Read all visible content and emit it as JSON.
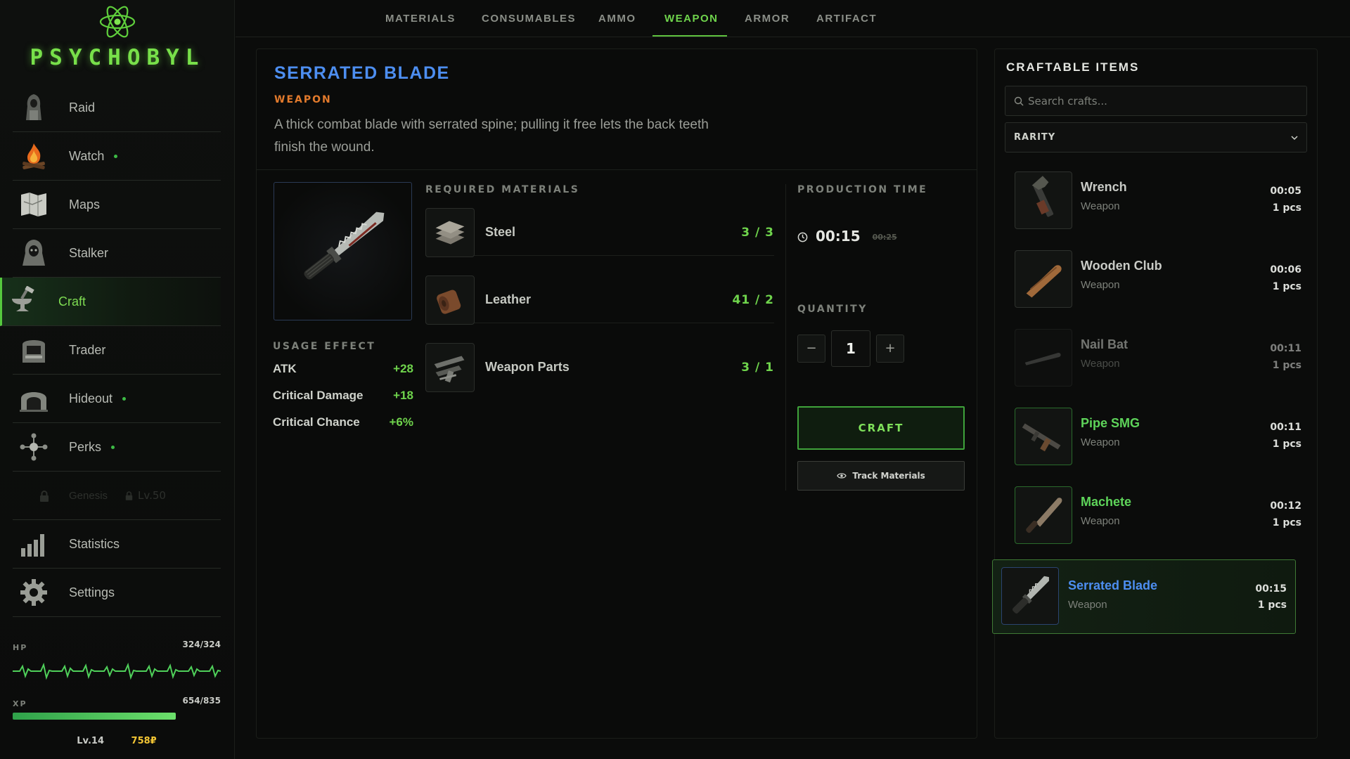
{
  "app": {
    "title": "PSYCHOBYL"
  },
  "sidebar": {
    "items": [
      {
        "label": "Raid",
        "icon": "hooded-figure-icon",
        "dot": false
      },
      {
        "label": "Watch",
        "icon": "campfire-icon",
        "dot": true
      },
      {
        "label": "Maps",
        "icon": "map-icon",
        "dot": false
      },
      {
        "label": "Stalker",
        "icon": "stalker-icon",
        "dot": false
      },
      {
        "label": "Craft",
        "icon": "anvil-icon",
        "dot": false,
        "active": true
      },
      {
        "label": "Trader",
        "icon": "trader-booth-icon",
        "dot": false
      },
      {
        "label": "Hideout",
        "icon": "bunker-icon",
        "dot": true
      },
      {
        "label": "Perks",
        "icon": "perks-icon",
        "dot": true
      },
      {
        "label": "Genesis",
        "icon": "lock-icon",
        "locked": true,
        "level": "Lv.50"
      },
      {
        "label": "Statistics",
        "icon": "bar-chart-icon",
        "dot": false
      },
      {
        "label": "Settings",
        "icon": "gear-icon",
        "dot": false
      }
    ]
  },
  "player": {
    "hp_label": "HP",
    "hp_value": "324/324",
    "xp_label": "XP",
    "xp_value": "654/835",
    "xp_fraction": 0.783,
    "level": "Lv.14",
    "money": "758₽"
  },
  "tabs": [
    {
      "label": "MATERIALS"
    },
    {
      "label": "CONSUMABLES"
    },
    {
      "label": "AMMO"
    },
    {
      "label": "WEAPON",
      "active": true
    },
    {
      "label": "ARMOR"
    },
    {
      "label": "ARTIFACT"
    }
  ],
  "detail": {
    "title": "SERRATED BLADE",
    "type": "WEAPON",
    "description": "A thick combat blade with serrated spine; pulling it free lets the back teeth finish the wound.",
    "usage_title": "USAGE EFFECT",
    "effects": [
      {
        "label": "ATK",
        "value": "+28"
      },
      {
        "label": "Critical Damage",
        "value": "+18"
      },
      {
        "label": "Critical Chance",
        "value": "+6%"
      }
    ],
    "materials_title": "REQUIRED MATERIALS",
    "materials": [
      {
        "name": "Steel",
        "count": "3 / 3",
        "icon": "steel-plates-icon"
      },
      {
        "name": "Leather",
        "count": "41 / 2",
        "icon": "leather-roll-icon"
      },
      {
        "name": "Weapon Parts",
        "count": "3 / 1",
        "icon": "weapon-parts-icon"
      }
    ],
    "production_title": "PRODUCTION TIME",
    "production_time": "00:15",
    "production_time_old": "00:25",
    "quantity_title": "QUANTITY",
    "quantity": "1",
    "minus": "−",
    "plus": "+",
    "craft_label": "CRAFT",
    "track_label": "Track Materials"
  },
  "craftable": {
    "title": "CRAFTABLE ITEMS",
    "search_placeholder": "Search crafts...",
    "rarity_label": "RARITY",
    "items": [
      {
        "name": "Wrench",
        "type": "Weapon",
        "time": "00:05",
        "qty": "1 pcs",
        "icon": "wrench-icon",
        "state": "normal"
      },
      {
        "name": "Wooden Club",
        "type": "Weapon",
        "time": "00:06",
        "qty": "1 pcs",
        "icon": "club-icon",
        "state": "normal"
      },
      {
        "name": "Nail Bat",
        "type": "Weapon",
        "time": "00:11",
        "qty": "1 pcs",
        "icon": "nail-bat-icon",
        "state": "dim"
      },
      {
        "name": "Pipe SMG",
        "type": "Weapon",
        "time": "00:11",
        "qty": "1 pcs",
        "icon": "smg-icon",
        "state": "green"
      },
      {
        "name": "Machete",
        "type": "Weapon",
        "time": "00:12",
        "qty": "1 pcs",
        "icon": "machete-icon",
        "state": "green"
      },
      {
        "name": "Serrated Blade",
        "type": "Weapon",
        "time": "00:15",
        "qty": "1 pcs",
        "icon": "knife-icon",
        "state": "selected"
      }
    ]
  },
  "colors": {
    "accent_green": "#6fd44c",
    "title_blue": "#4d8ef0",
    "type_orange": "#e27a2c",
    "money_gold": "#f2c534"
  }
}
